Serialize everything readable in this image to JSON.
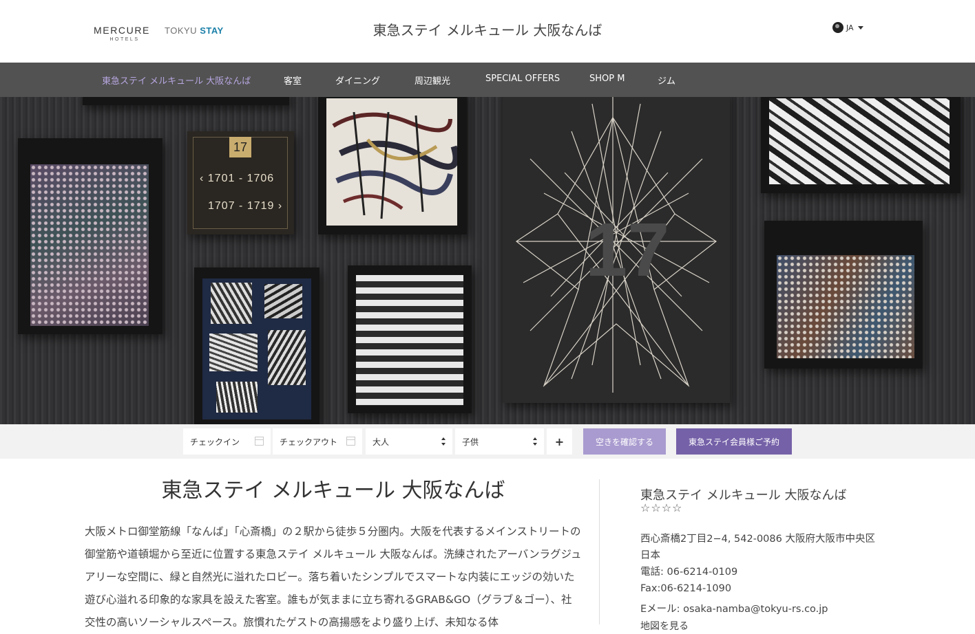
{
  "header": {
    "logo_mercure": "MERCURE",
    "logo_mercure_sub": "HOTELS",
    "logo_tokyu_a": "TOKYU",
    "logo_tokyu_b": "STAY",
    "site_title": "東急ステイ メルキュール 大阪なんば",
    "language": "JA"
  },
  "nav": {
    "items": [
      {
        "label": "東急ステイ メルキュール 大阪なんば",
        "active": true
      },
      {
        "label": "客室"
      },
      {
        "label": "ダイニング"
      },
      {
        "label": "周辺観光"
      },
      {
        "label": "SPECIAL OFFERS"
      },
      {
        "label": "SHOP M"
      },
      {
        "label": "ジム"
      }
    ]
  },
  "hero": {
    "sign_floor": "17",
    "sign_rooms_left": "1701 - 1706",
    "sign_rooms_right": "1707 - 1719"
  },
  "booking": {
    "checkin_placeholder": "チェックイン",
    "checkout_placeholder": "チェックアウト",
    "adults_label": "大人",
    "children_label": "子供",
    "add_room": "+",
    "check_availability": "空きを確認する",
    "member_booking": "東急ステイ会員様ご予約"
  },
  "content": {
    "title": "東急ステイ メルキュール 大阪なんば",
    "description": "大阪メトロ御堂筋線「なんば」「心斎橋」の２駅から徒歩５分圏内。大阪を代表するメインストリートの御堂筋や道頓堀から至近に位置する東急ステイ メルキュール 大阪なんば。洗練されたアーバンラグジュアリーな空間に、緑と自然光に溢れたロビー。落ち着いたシンプルでスマートな内装にエッジの効いた遊び心溢れる印象的な家具を設えた客室。誰もが気ままに立ち寄れるGRAB&GO（グラブ＆ゴー）、社交性の高いソーシャルスペース。旅慣れたゲストの高揚感をより盛り上げ、未知なる体"
  },
  "sidebar": {
    "hotel_name": "東急ステイ メルキュール 大阪なんば",
    "stars": "☆☆☆☆",
    "address": "西心斎橋2丁目2−4, 542-0086 大阪府大阪市中央区",
    "country": "日本",
    "phone": "電話: 06-6214-0109",
    "fax": "Fax:06-6214-1090",
    "email_label": "Eメール: ",
    "email": "osaka-namba@tokyu-rs.co.jp",
    "map_link": "地図を見る"
  },
  "colors": {
    "nav_bg": "#525252",
    "nav_active": "#b7a6e0",
    "btn_light_purple": "#a99bcf",
    "btn_dark_purple": "#7561a8",
    "booking_bg": "#f2f2f2"
  }
}
